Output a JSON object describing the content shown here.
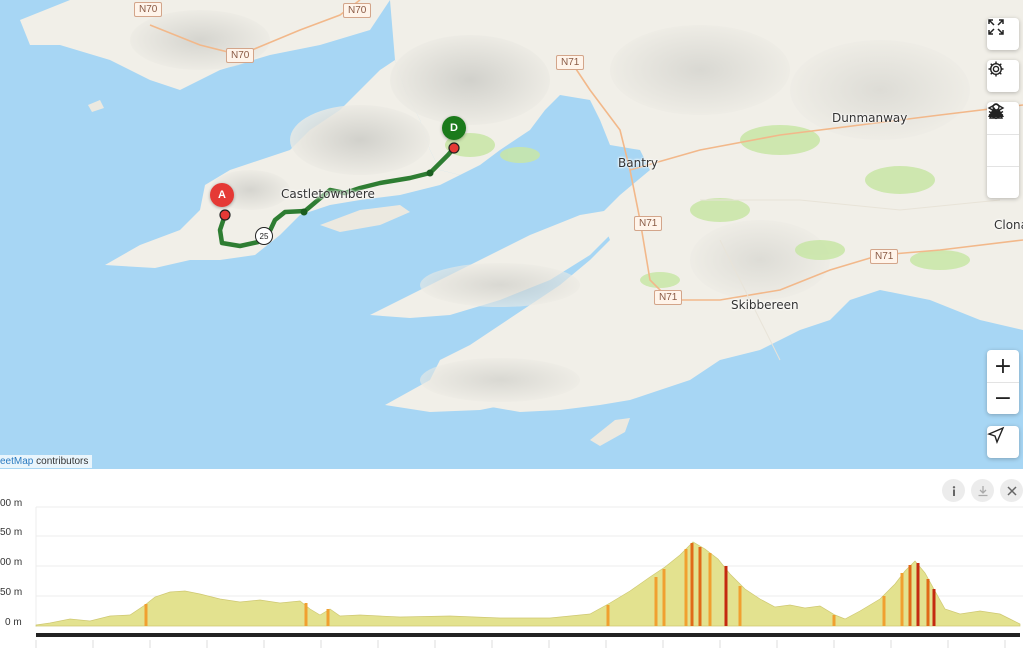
{
  "map": {
    "towns": [
      {
        "name": "Dunmanway"
      },
      {
        "name": "Bantry"
      },
      {
        "name": "Skibbereen"
      },
      {
        "name": "Castletownbere"
      },
      {
        "name": "Clona"
      }
    ],
    "road_shields": [
      "N70",
      "N70",
      "N70",
      "N71",
      "N71",
      "N71",
      "N71"
    ],
    "route_markers": {
      "start": "A",
      "end": "D",
      "waypoint": "25"
    },
    "attribution": {
      "link": "eetMap",
      "text": " contributors"
    },
    "route_color": "#2e7d32",
    "start_color": "#e53935",
    "end_color": "#1b7a1b"
  },
  "controls": {
    "fullscreen": "fullscreen-icon",
    "settings": "gear-icon",
    "layers": "layers-icon",
    "terrain": "mountain-icon",
    "poi": "pin-icon",
    "zoom_in": "+",
    "zoom_out": "−",
    "locate": "locate-icon"
  },
  "elevation_panel": {
    "buttons": [
      "info-icon",
      "download-icon",
      "close-icon"
    ],
    "y_axis_labels": [
      "00 m",
      "50 m",
      "00 m",
      "50 m",
      "0 m"
    ]
  }
}
